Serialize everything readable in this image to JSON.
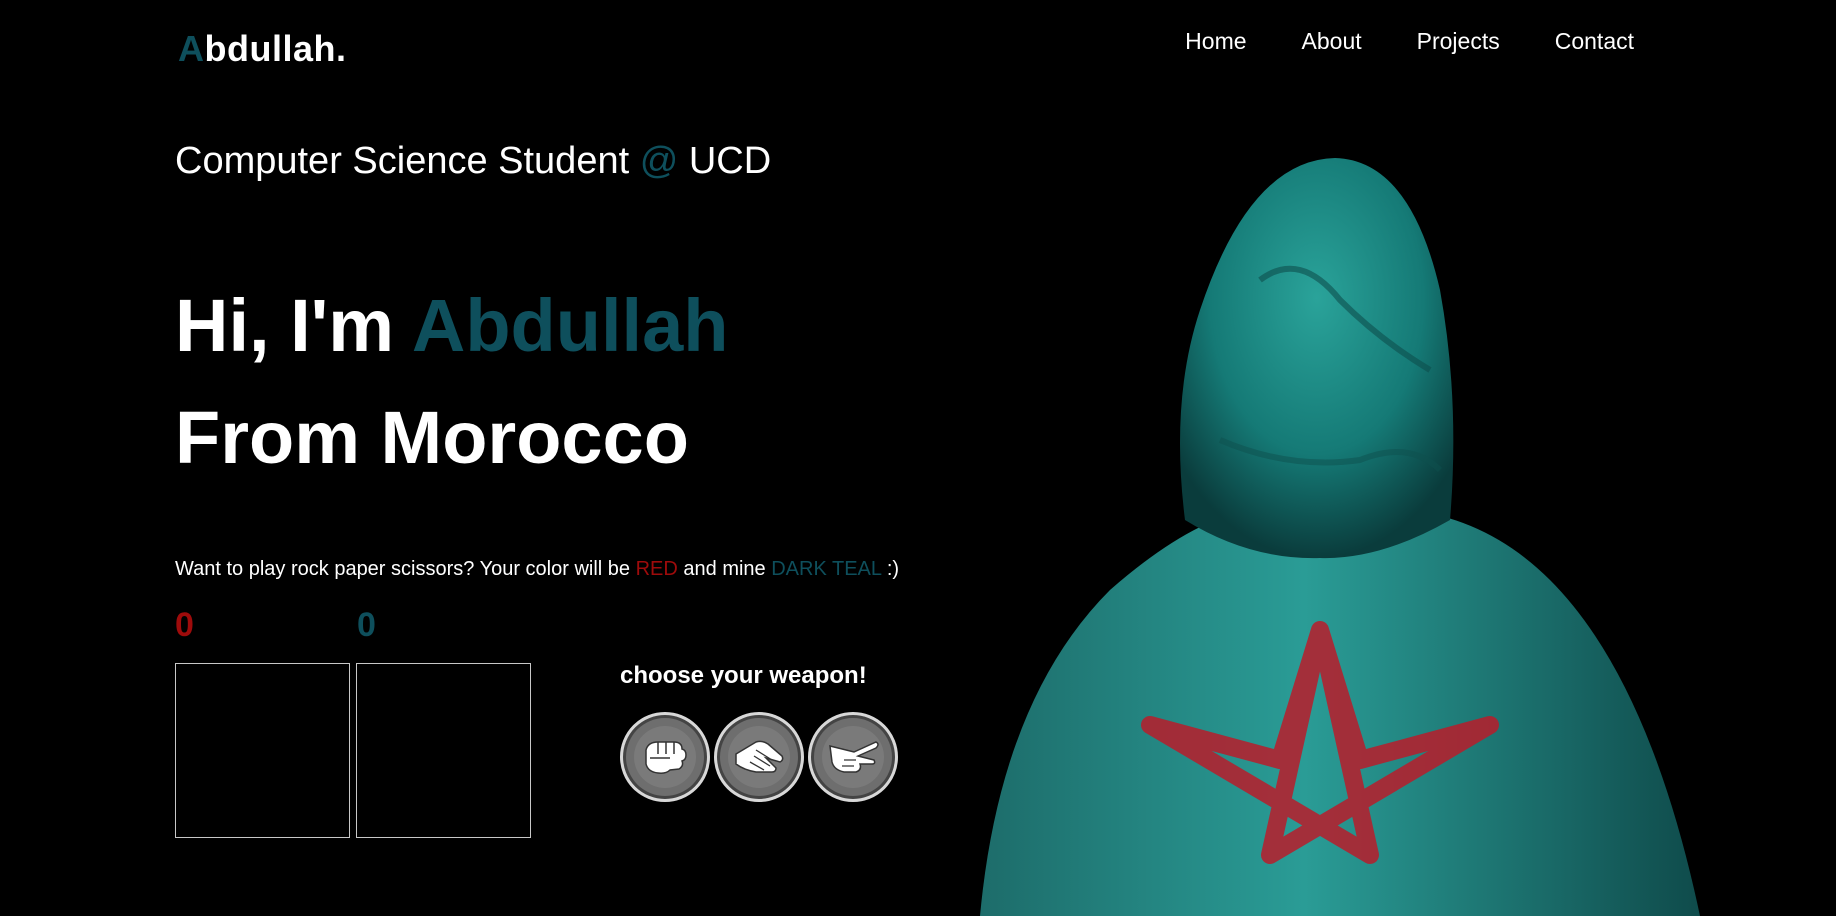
{
  "header": {
    "logo_first": "A",
    "logo_rest": "bdullah."
  },
  "nav": {
    "items": [
      "Home",
      "About",
      "Projects",
      "Contact"
    ]
  },
  "intro": {
    "subtitle_prefix": "Computer Science Student",
    "subtitle_at": "@",
    "subtitle_suffix": "UCD",
    "greeting": "Hi, I'm",
    "name": "Abdullah",
    "origin": "From Morocco"
  },
  "game": {
    "prompt_prefix": "Want to play rock paper scissors? Your color will be",
    "player_color_word": "RED",
    "prompt_middle": "and mine",
    "computer_color_word": "DARK TEAL",
    "prompt_suffix": ":)",
    "player_score": "0",
    "computer_score": "0",
    "choose_label": "choose your weapon!",
    "weapons": [
      "rock-icon",
      "paper-icon",
      "scissors-icon"
    ]
  },
  "colors": {
    "accent": "#0e4f5c",
    "player": "#9e0b0b",
    "background": "#000000"
  }
}
